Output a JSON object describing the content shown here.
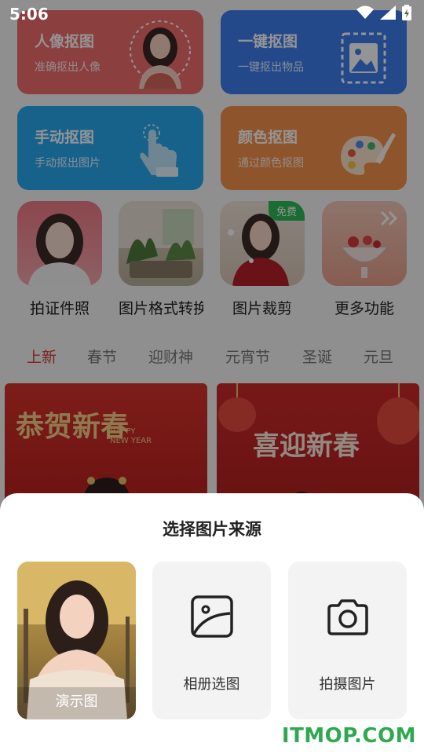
{
  "status": {
    "time": "5:06"
  },
  "tools": [
    {
      "title": "人像抠图",
      "subtitle": "准确抠出人像",
      "color": "#f26d6d",
      "icon": "portrait-cutout-icon"
    },
    {
      "title": "一键抠图",
      "subtitle": "一键抠出物品",
      "color": "#3d7ff0",
      "icon": "image-cutout-icon"
    },
    {
      "title": "手动抠图",
      "subtitle": "手动抠出图片",
      "color": "#29a9ef",
      "icon": "hand-pointer-icon"
    },
    {
      "title": "颜色抠图",
      "subtitle": "通过颜色抠图",
      "color": "#f5914a",
      "icon": "palette-icon"
    }
  ],
  "features": [
    {
      "label": "拍证件照"
    },
    {
      "label": "图片格式转换"
    },
    {
      "label": "图片裁剪",
      "badge": "免费"
    },
    {
      "label": "更多功能"
    }
  ],
  "tabs": [
    "上新",
    "春节",
    "迎财神",
    "元宵节",
    "圣诞",
    "元旦"
  ],
  "banners": [
    {
      "title": "恭贺新春",
      "subtitle_line1": "HAPPY",
      "subtitle_line2": "NEW YEAR"
    },
    {
      "title": "喜迎新春"
    }
  ],
  "sheet": {
    "title": "选择图片来源",
    "demo_label": "演示图",
    "album_label": "相册选图",
    "camera_label": "拍摄图片"
  },
  "watermark": "ITMOP.COM"
}
